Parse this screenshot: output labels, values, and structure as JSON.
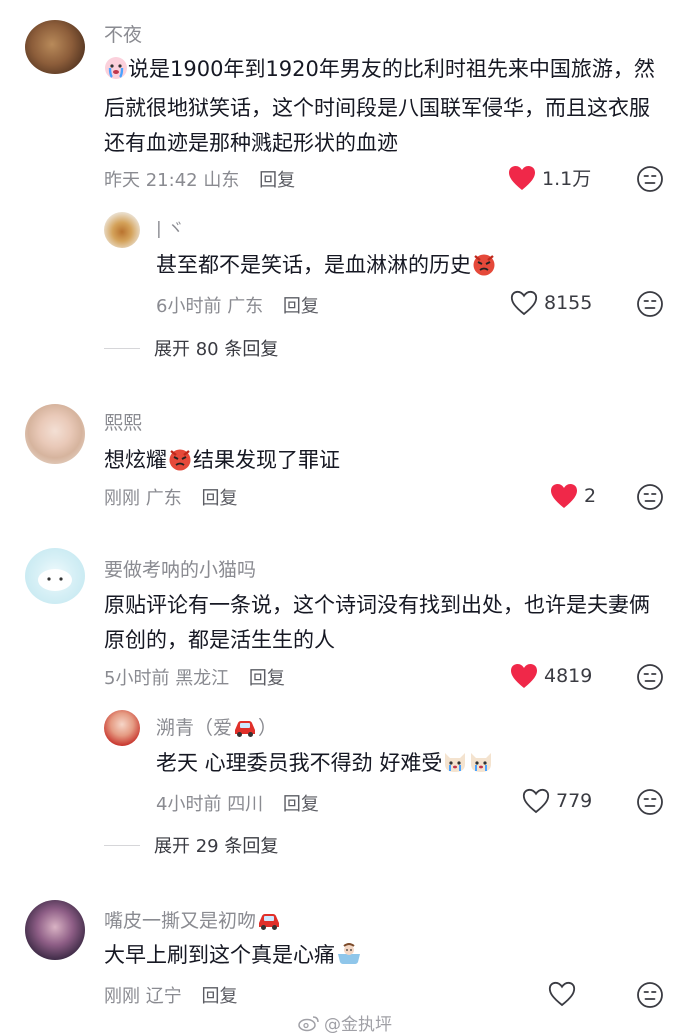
{
  "comments": [
    {
      "user": "不夜",
      "text": "说是1900年到1920年男友的比利时祖先来中国旅游，然后就很地狱笑话，这个时间段是八国联军侵华，而且这衣服还有血迹是那种溅起形状的血迹",
      "time": "昨天 21:42",
      "location": "山东",
      "reply_label": "回复",
      "likes": "1.1万",
      "liked": true,
      "reply": {
        "user": "| ヾ",
        "text": "甚至都不是笑话，是血淋淋的历史",
        "time": "6小时前",
        "location": "广东",
        "reply_label": "回复",
        "likes": "8155",
        "liked": false
      },
      "expand_label": "展开 80 条回复"
    },
    {
      "user": "熙熙",
      "text_before": "想炫耀",
      "text_after": "结果发现了罪证",
      "time": "刚刚",
      "location": "广东",
      "reply_label": "回复",
      "likes": "2",
      "liked": true
    },
    {
      "user": "要做考呐的小猫吗",
      "text": "原贴评论有一条说，这个诗词没有找到出处，也许是夫妻俩原创的，都是活生生的人",
      "time": "5小时前",
      "location": "黑龙江",
      "reply_label": "回复",
      "likes": "4819",
      "liked": true,
      "reply": {
        "user": "溯青（爱",
        "user_suffix": "）",
        "text": "老天 心理委员我不得劲 好难受",
        "time": "4小时前",
        "location": "四川",
        "reply_label": "回复",
        "likes": "779",
        "liked": false
      },
      "expand_label": "展开 29 条回复"
    },
    {
      "user": "嘴皮一撕又是初吻",
      "text": "大早上刷到这个真是心痛",
      "time": "刚刚",
      "location": "辽宁",
      "reply_label": "回复",
      "likes": "",
      "liked": false
    }
  ],
  "watermark": "@金执坪",
  "colors": {
    "heart_red": "#f02849",
    "meta_gray": "#8a8b91",
    "text": "#161823"
  },
  "icons": [
    "heart-filled-icon",
    "heart-outline-icon",
    "dislike-face-icon",
    "crying-emoji-icon",
    "angry-emoji-icon",
    "car-emoji-icon",
    "dog-crying-emoji-icon",
    "bath-emoji-icon",
    "weibo-logo-icon"
  ]
}
